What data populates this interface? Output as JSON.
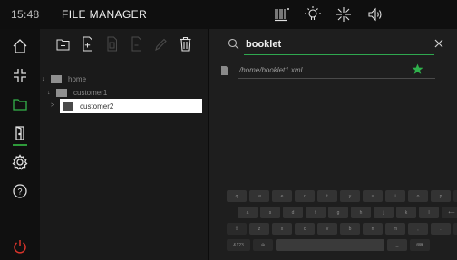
{
  "header": {
    "clock": "15:48",
    "title": "FILE MANAGER",
    "status_icons": [
      "barcode-icon",
      "lightbulb-icon",
      "brightness-icon",
      "speaker-icon"
    ]
  },
  "sidebar": {
    "items": [
      {
        "name": "home",
        "icon": "home-icon"
      },
      {
        "name": "fullscreen",
        "icon": "expand-icon"
      },
      {
        "name": "file-manager",
        "icon": "folder-icon",
        "active": true
      },
      {
        "name": "door",
        "icon": "door-icon"
      },
      {
        "name": "settings",
        "icon": "gear-icon"
      },
      {
        "name": "help",
        "icon": "help-icon"
      },
      {
        "name": "power",
        "icon": "power-icon"
      }
    ],
    "accent": "#2e9a3a",
    "power_color": "#d9342b"
  },
  "toolbar": {
    "icons": [
      "new-folder-icon",
      "new-file-icon",
      "copy-icon",
      "paste-icon",
      "rename-icon",
      "delete-icon"
    ]
  },
  "tree": [
    {
      "label": "home",
      "arrow": "↓",
      "level": 0,
      "selected": false
    },
    {
      "label": "customer1",
      "arrow": "↓",
      "level": 1,
      "selected": false
    },
    {
      "label": "customer2",
      "arrow": ">",
      "level": 2,
      "selected": true
    }
  ],
  "search": {
    "value": "booklet",
    "placeholder": ""
  },
  "results": [
    {
      "path": "/home/booklet1.xml",
      "favorite": true
    }
  ],
  "keyboard": {
    "row1": [
      "q",
      "w",
      "e",
      "r",
      "t",
      "y",
      "u",
      "i",
      "o",
      "p",
      "⌫"
    ],
    "row2": [
      "a",
      "s",
      "d",
      "f",
      "g",
      "h",
      "j",
      "k",
      "l",
      "⟵"
    ],
    "row3": [
      "⇧",
      "z",
      "x",
      "c",
      "v",
      "b",
      "n",
      "m",
      ",",
      ".",
      "⇧"
    ],
    "row4": [
      "&123",
      "⊕",
      "",
      "_",
      "⌨"
    ]
  }
}
